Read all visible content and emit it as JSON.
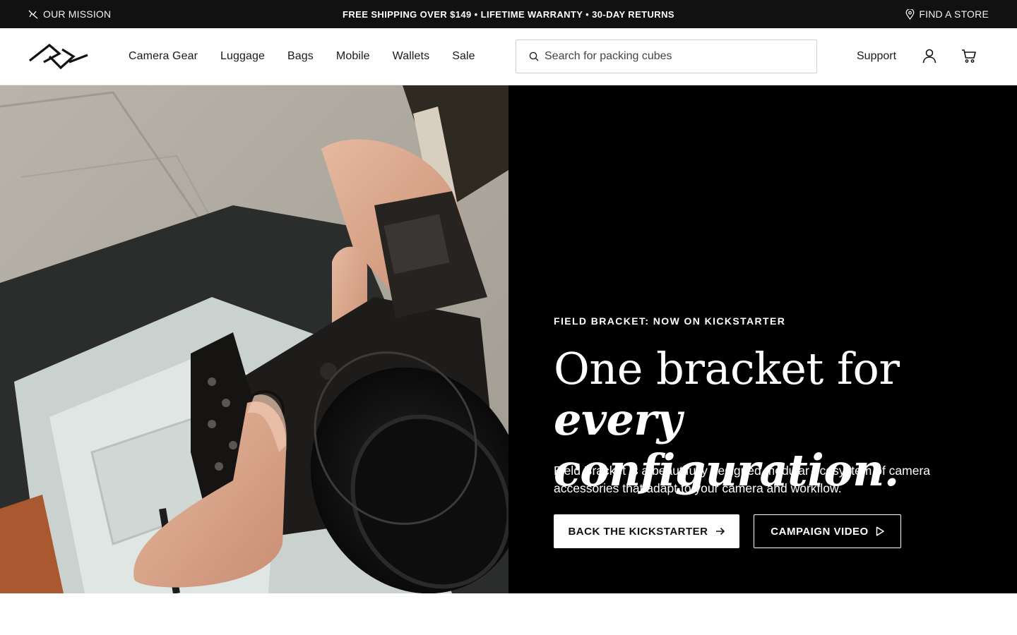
{
  "colors": {
    "topbar_bg": "#111111",
    "hero_panel_bg": "#000000",
    "primary_button_bg": "#ffffff",
    "text_dark": "#111111",
    "text_light": "#ffffff"
  },
  "topbar": {
    "mission_icon": "peak-icon",
    "mission_label": "OUR MISSION",
    "announcement": "FREE SHIPPING OVER $149 • LIFETIME WARRANTY • 30-DAY RETURNS",
    "store_icon": "map-pin-icon",
    "store_label": "FIND A STORE"
  },
  "header": {
    "logo_icon": "brand-logo-icon",
    "nav": [
      "Camera Gear",
      "Luggage",
      "Bags",
      "Mobile",
      "Wallets",
      "Sale"
    ],
    "search": {
      "icon": "search-icon",
      "placeholder": "Search for packing cubes",
      "value": ""
    },
    "support_label": "Support",
    "account_icon": "user-icon",
    "cart_icon": "cart-icon"
  },
  "hero": {
    "image": "hands holding a camera with bracket over an open camera bag",
    "eyebrow": "FIELD BRACKET: NOW ON KICKSTARTER",
    "headline_line1": "One bracket for",
    "headline_line2": "every configuration.",
    "description": "Field Bracket is a beautifully designed modular ecosystem of camera accessories that adapt to your camera and workflow.",
    "primary_cta": {
      "label": "BACK THE KICKSTARTER",
      "icon": "arrow-right-icon"
    },
    "secondary_cta": {
      "label": "CAMPAIGN VIDEO",
      "icon": "play-icon"
    }
  }
}
